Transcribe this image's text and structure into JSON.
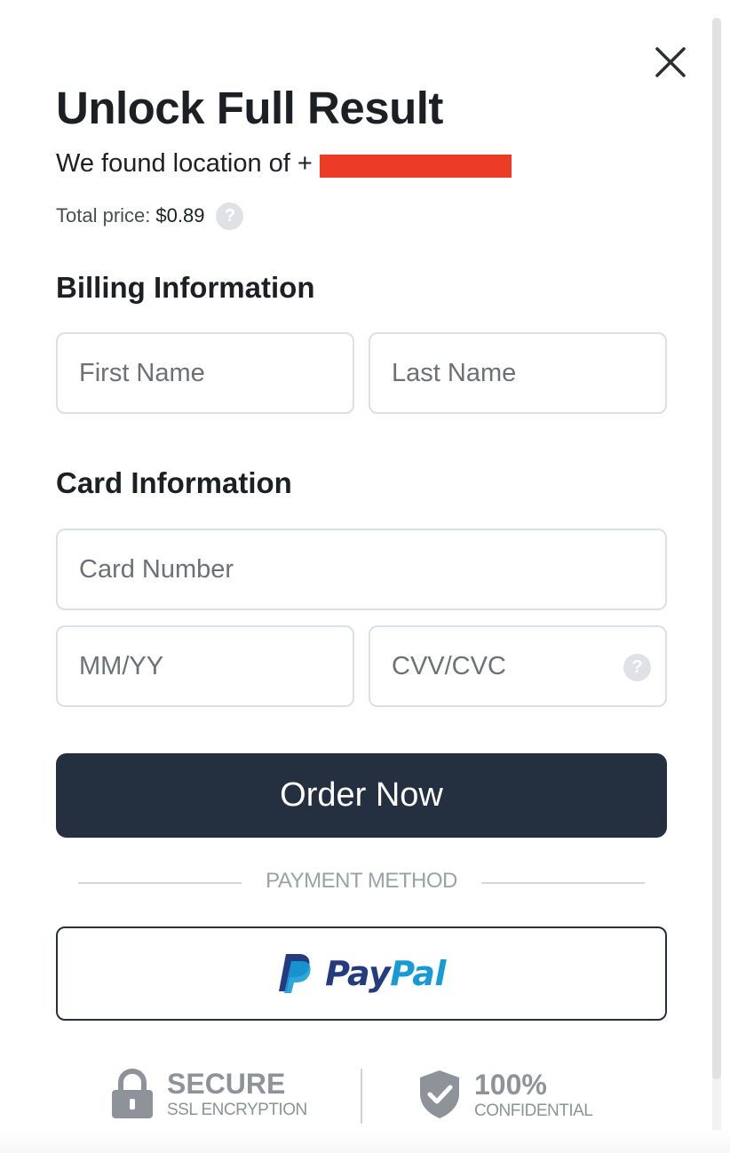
{
  "modal": {
    "title": "Unlock Full Result",
    "subtitle": "We found location of +",
    "price_label": "Total price:",
    "price_value": "$0.89",
    "help_glyph": "?",
    "close_icon": "close-icon"
  },
  "billing": {
    "heading": "Billing Information",
    "first_name_placeholder": "First Name",
    "last_name_placeholder": "Last Name"
  },
  "card": {
    "heading": "Card Information",
    "number_placeholder": "Card Number",
    "expiry_placeholder": "MM/YY",
    "cvv_placeholder": "CVV/CVC"
  },
  "order_button": "Order Now",
  "payment_method_label": "PAYMENT METHOD",
  "paypal": {
    "pay": "Pay",
    "pal": "Pal",
    "icon": "paypal-icon"
  },
  "badges": {
    "secure_title": "SECURE",
    "secure_sub": "SSL ENCRYPTION",
    "confidential_title": "100%",
    "confidential_sub": "CONFIDENTIAL"
  },
  "colors": {
    "primary_button": "#243040",
    "redaction": "#ec3b26",
    "paypal_dark": "#253b80",
    "paypal_light": "#179bd7"
  }
}
